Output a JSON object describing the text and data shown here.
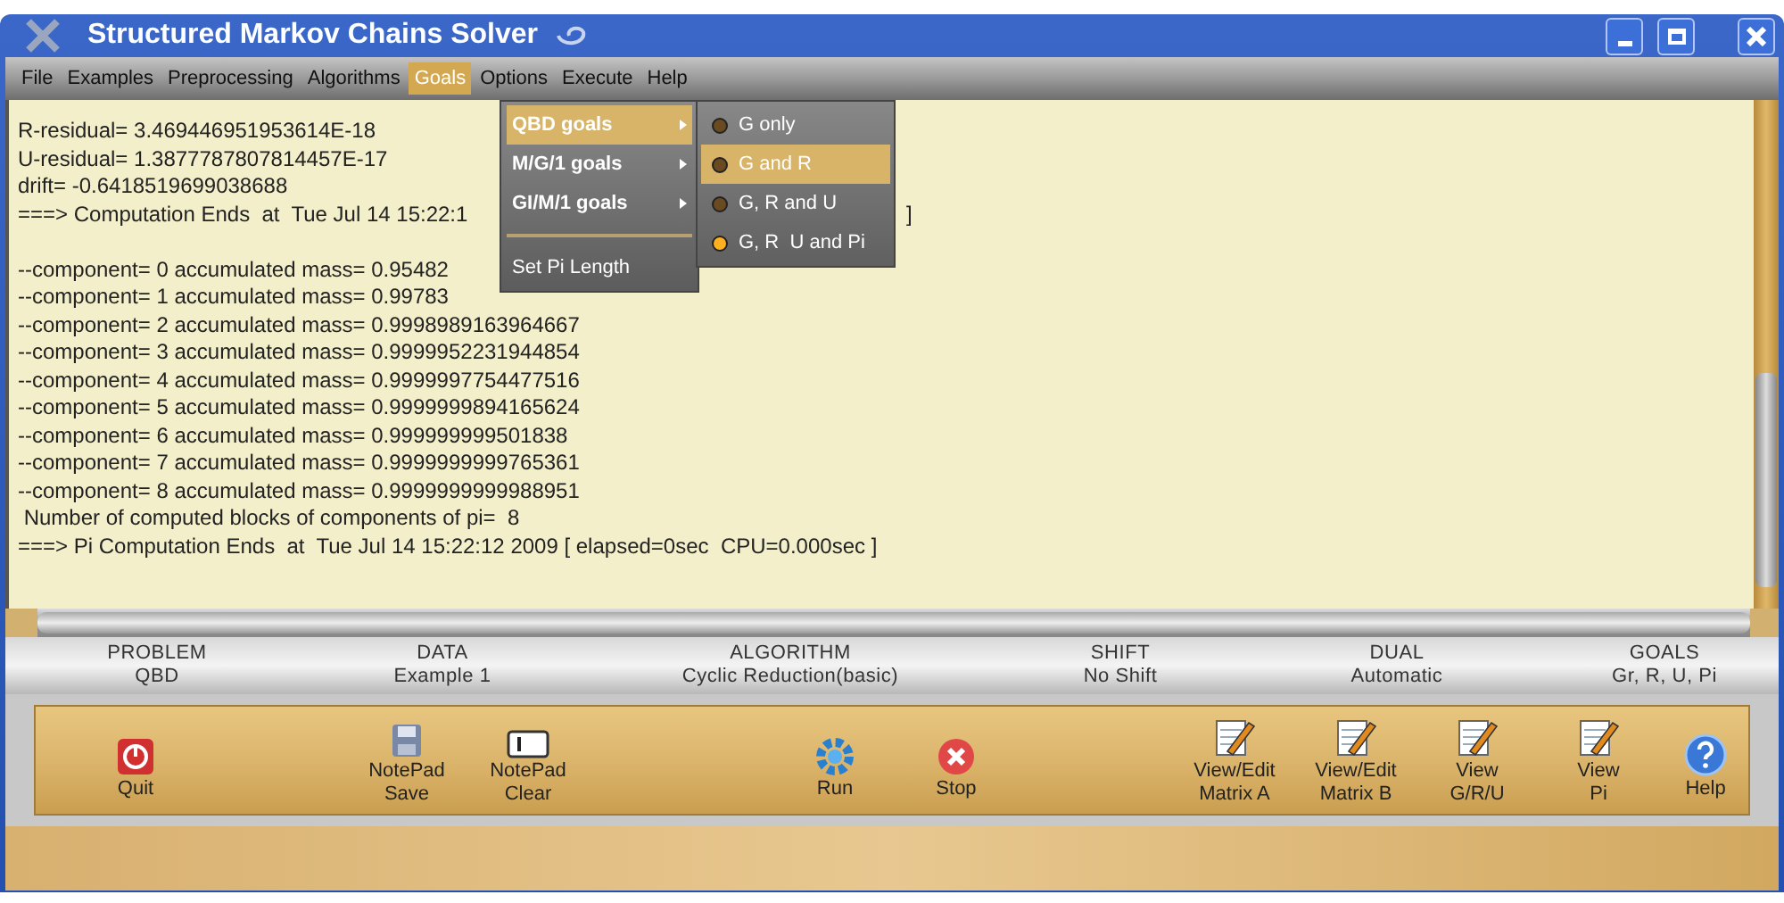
{
  "window": {
    "title": "Structured Markov Chains Solver"
  },
  "menu_bar": [
    {
      "label": "File",
      "selected": false
    },
    {
      "label": "Examples",
      "selected": false
    },
    {
      "label": "Preprocessing",
      "selected": false
    },
    {
      "label": "Algorithms",
      "selected": false
    },
    {
      "label": "Goals",
      "selected": true
    },
    {
      "label": "Options",
      "selected": false
    },
    {
      "label": "Execute",
      "selected": false
    },
    {
      "label": "Help",
      "selected": false
    }
  ],
  "output": [
    [
      {
        "text": "R-residual= 3.469446951953614E-18"
      },
      {
        "text": "U-residual= 1.3877787807814457E-17"
      },
      {
        "text": "drift= -0.6418519699038688"
      },
      {
        "text": "===> Computation Ends  at  Tue Jul 14 15:22:1",
        "tail": "]"
      }
    ],
    [
      {
        "text": "--component= 0 accumulated mass= 0.95482"
      },
      {
        "text": "--component= 1 accumulated mass= 0.99783"
      },
      {
        "text": "--component= 2 accumulated mass= 0.9998989163964667"
      },
      {
        "text": "--component= 3 accumulated mass= 0.9999952231944854"
      },
      {
        "text": "--component= 4 accumulated mass= 0.9999997754477516"
      },
      {
        "text": "--component= 5 accumulated mass= 0.9999999894165624"
      },
      {
        "text": "--component= 6 accumulated mass= 0.999999999501838"
      },
      {
        "text": "--component= 7 accumulated mass= 0.9999999999765361"
      },
      {
        "text": "--component= 8 accumulated mass= 0.9999999999988951"
      },
      {
        "text": " Number of computed blocks of components of pi=  8"
      },
      {
        "text": "===> Pi Computation Ends  at  Tue Jul 14 15:22:12 2009 [ elapsed=0sec  CPU=0.000sec ]"
      }
    ]
  ],
  "goals_menu": [
    {
      "kind": "submenu",
      "label": "QBD goals",
      "selected": true
    },
    {
      "kind": "submenu",
      "label": "M/G/1 goals",
      "selected": false
    },
    {
      "kind": "submenu",
      "label": "GI/M/1 goals",
      "selected": false
    },
    {
      "kind": "separator"
    },
    {
      "kind": "item",
      "label": "Set Pi Length",
      "selected": false
    }
  ],
  "qbd_submenu": [
    {
      "label": "G only",
      "selected": false,
      "checked": false
    },
    {
      "label": "G and R",
      "selected": true,
      "checked": false
    },
    {
      "label": "G, R and U",
      "selected": false,
      "checked": false
    },
    {
      "label": "G, R  U and Pi",
      "selected": false,
      "checked": true
    }
  ],
  "status": [
    {
      "heading": "PROBLEM",
      "value": "QBD"
    },
    {
      "heading": "DATA",
      "value": "Example 1"
    },
    {
      "heading": "ALGORITHM",
      "value": "Cyclic Reduction(basic)"
    },
    {
      "heading": "SHIFT",
      "value": "No Shift"
    },
    {
      "heading": "DUAL",
      "value": "Automatic"
    },
    {
      "heading": "GOALS",
      "value": "Gr, R, U, Pi"
    }
  ],
  "toolbar": [
    [
      {
        "kind": "quit",
        "lines": [
          "Quit"
        ]
      }
    ],
    [
      {
        "kind": "save",
        "lines": [
          "NotePad",
          "Save"
        ]
      },
      {
        "kind": "clear",
        "lines": [
          "NotePad",
          "Clear"
        ]
      }
    ],
    [
      {
        "kind": "run",
        "lines": [
          "Run"
        ]
      },
      {
        "kind": "stop",
        "lines": [
          "Stop"
        ]
      }
    ],
    [
      {
        "kind": "view",
        "lines": [
          "View/Edit",
          "Matrix A"
        ]
      },
      {
        "kind": "view",
        "lines": [
          "View/Edit",
          "Matrix B"
        ]
      },
      {
        "kind": "view",
        "lines": [
          "View",
          "G/R/U"
        ]
      },
      {
        "kind": "view",
        "lines": [
          "View",
          "Pi"
        ]
      }
    ],
    [
      {
        "kind": "help",
        "lines": [
          "Help"
        ]
      }
    ]
  ]
}
